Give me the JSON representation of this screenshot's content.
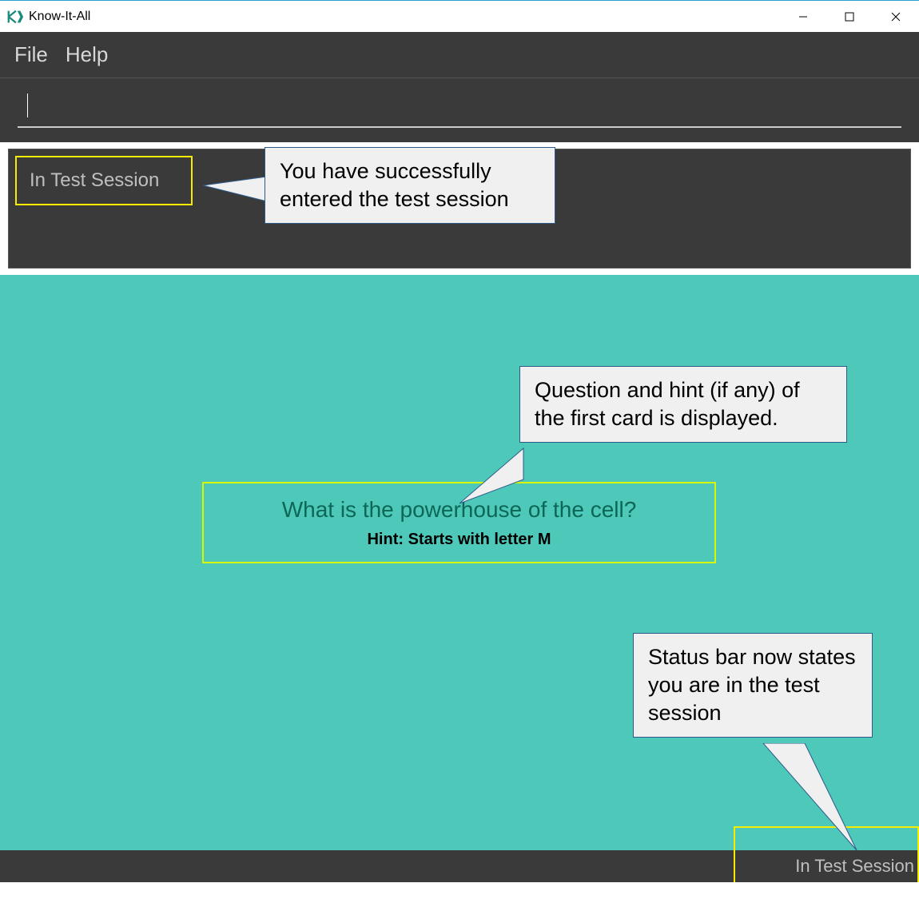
{
  "titlebar": {
    "app_title": "Know-It-All"
  },
  "menubar": {
    "file": "File",
    "help": "Help"
  },
  "input": {
    "value": ""
  },
  "session": {
    "label": "In Test Session"
  },
  "callouts": {
    "c1": "You have successfully entered the test session",
    "c2": "Question and hint (if any) of the first card is displayed.",
    "c3": "Status bar now states you are in the test session"
  },
  "card": {
    "question": "What is the powerhouse of the cell?",
    "hint": "Hint: Starts with letter M"
  },
  "statusbar": {
    "text": "In Test Session"
  }
}
